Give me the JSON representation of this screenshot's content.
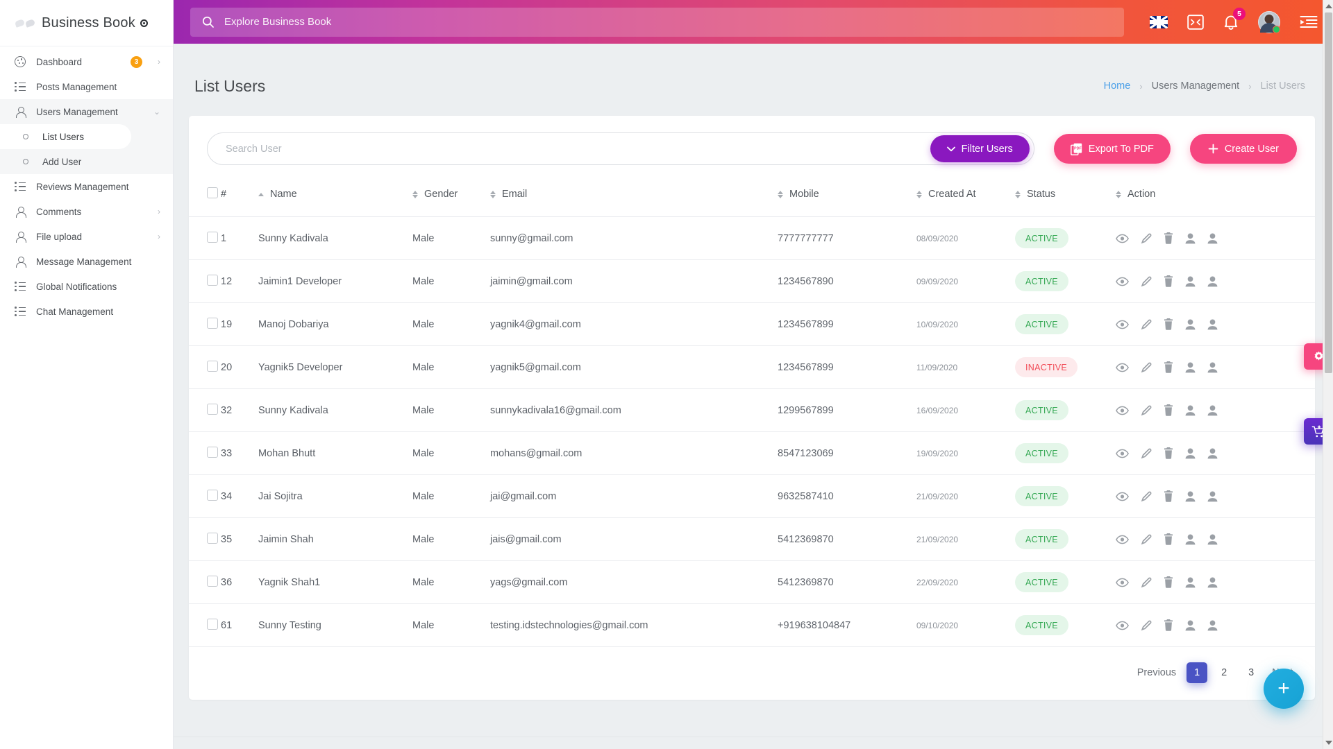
{
  "brand": {
    "name": "Business Book"
  },
  "sidebar": {
    "items": [
      {
        "label": "Dashboard",
        "icon": "dashboard-icon",
        "badge": "3",
        "chevron": "›"
      },
      {
        "label": "Posts Management",
        "icon": "list-icon",
        "badge": "",
        "chevron": ""
      },
      {
        "label": "Users Management",
        "icon": "person-icon",
        "badge": "",
        "chevron": "⌄"
      }
    ],
    "subitems": [
      {
        "label": "List Users",
        "icon": "circle-icon",
        "active": true
      },
      {
        "label": "Add User",
        "icon": "circle-icon",
        "active": false
      }
    ],
    "items_after": [
      {
        "label": "Reviews Management",
        "icon": "list-icon",
        "badge": "",
        "chevron": ""
      },
      {
        "label": "Comments",
        "icon": "person-icon",
        "badge": "",
        "chevron": "›"
      },
      {
        "label": "File upload",
        "icon": "person-icon",
        "badge": "",
        "chevron": "›"
      },
      {
        "label": "Message Management",
        "icon": "person-icon",
        "badge": "",
        "chevron": ""
      },
      {
        "label": "Global Notifications",
        "icon": "list-icon",
        "badge": "",
        "chevron": ""
      },
      {
        "label": "Chat Management",
        "icon": "list-icon",
        "badge": "",
        "chevron": ""
      }
    ]
  },
  "topbar": {
    "search_placeholder": "Explore Business Book",
    "search_value": "",
    "search_icon": "search-icon",
    "flag_icon": "uk-flag-icon",
    "fullscreen_icon": "fullscreen-icon",
    "bell_icon": "bell-icon",
    "notification_count": "5",
    "avatar_icon": "user-avatar",
    "menu_icon": "toggle-sidebar-icon"
  },
  "page": {
    "title": "List Users",
    "breadcrumb": {
      "home": "Home",
      "section": "Users Management",
      "current": "List Users",
      "separator": "›"
    }
  },
  "toolbar": {
    "search_placeholder": "Search User",
    "search_value": "",
    "filter_label": "Filter Users",
    "filter_icon": "chevron-down-icon",
    "export_label": "Export To PDF",
    "export_icon": "pdf-icon",
    "create_label": "Create User",
    "create_icon": "plus-icon"
  },
  "table": {
    "columns": [
      {
        "key": "checkbox",
        "label": "",
        "sortable": false
      },
      {
        "key": "id",
        "label": "#",
        "sortable": false
      },
      {
        "key": "name",
        "label": "Name",
        "sortable": true,
        "sort_state": "asc"
      },
      {
        "key": "gender",
        "label": "Gender",
        "sortable": true,
        "sort_state": "none"
      },
      {
        "key": "email",
        "label": "Email",
        "sortable": true,
        "sort_state": "none"
      },
      {
        "key": "mobile",
        "label": "Mobile",
        "sortable": true,
        "sort_state": "none"
      },
      {
        "key": "created_at",
        "label": "Created At",
        "sortable": true,
        "sort_state": "none"
      },
      {
        "key": "status",
        "label": "Status",
        "sortable": true,
        "sort_state": "none"
      },
      {
        "key": "action",
        "label": "Action",
        "sortable": true,
        "sort_state": "none"
      }
    ],
    "action_icons": [
      "eye-icon",
      "pencil-icon",
      "trash-icon",
      "person-add-icon",
      "person-icon"
    ],
    "rows": [
      {
        "id": "1",
        "name": "Sunny Kadivala",
        "gender": "Male",
        "email": "sunny@gmail.com",
        "mobile": "7777777777",
        "created_at": "08/09/2020",
        "status": "ACTIVE"
      },
      {
        "id": "12",
        "name": "Jaimin1 Developer",
        "gender": "Male",
        "email": "jaimin@gmail.com",
        "mobile": "1234567890",
        "created_at": "09/09/2020",
        "status": "ACTIVE"
      },
      {
        "id": "19",
        "name": "Manoj Dobariya",
        "gender": "Male",
        "email": "yagnik4@gmail.com",
        "mobile": "1234567899",
        "created_at": "10/09/2020",
        "status": "ACTIVE"
      },
      {
        "id": "20",
        "name": "Yagnik5 Developer",
        "gender": "Male",
        "email": "yagnik5@gmail.com",
        "mobile": "1234567899",
        "created_at": "11/09/2020",
        "status": "INACTIVE"
      },
      {
        "id": "32",
        "name": "Sunny Kadivala",
        "gender": "Male",
        "email": "sunnykadivala16@gmail.com",
        "mobile": "1299567899",
        "created_at": "16/09/2020",
        "status": "ACTIVE"
      },
      {
        "id": "33",
        "name": "Mohan Bhutt",
        "gender": "Male",
        "email": "mohans@gmail.com",
        "mobile": "8547123069",
        "created_at": "19/09/2020",
        "status": "ACTIVE"
      },
      {
        "id": "34",
        "name": "Jai Sojitra",
        "gender": "Male",
        "email": "jai@gmail.com",
        "mobile": "9632587410",
        "created_at": "21/09/2020",
        "status": "ACTIVE"
      },
      {
        "id": "35",
        "name": "Jaimin Shah",
        "gender": "Male",
        "email": "jais@gmail.com",
        "mobile": "5412369870",
        "created_at": "21/09/2020",
        "status": "ACTIVE"
      },
      {
        "id": "36",
        "name": "Yagnik Shah1",
        "gender": "Male",
        "email": "yags@gmail.com",
        "mobile": "5412369870",
        "created_at": "22/09/2020",
        "status": "ACTIVE"
      },
      {
        "id": "61",
        "name": "Sunny Testing",
        "gender": "Male",
        "email": "testing.idstechnologies@gmail.com",
        "mobile": "+919638104847",
        "created_at": "09/10/2020",
        "status": "ACTIVE"
      }
    ]
  },
  "pagination": {
    "previous": "Previous",
    "next": "Next",
    "pages": [
      "1",
      "2",
      "3"
    ],
    "current": "1"
  },
  "floating": {
    "settings_icon": "gear-icon",
    "cart_icon": "cart-add-icon",
    "fab_icon": "plus-icon",
    "fab_label": "+"
  },
  "colors": {
    "accent_pink": "#f6457f",
    "accent_purple": "#8a18bf",
    "active_green": "#34a853",
    "inactive_red": "#f14a56",
    "pagination_blue": "#4a53c4",
    "fab_blue": "#17a2d4",
    "badge_orange": "#f9a011",
    "link_blue": "#4a9fe8"
  }
}
